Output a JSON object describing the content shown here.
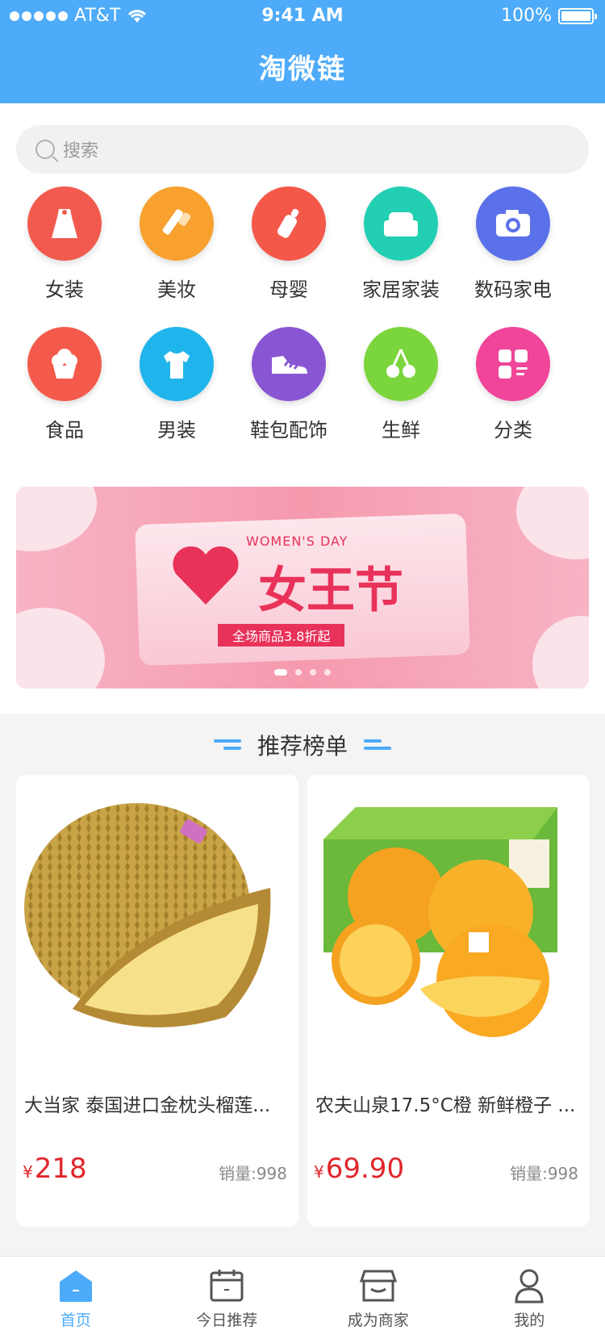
{
  "status_bar": {
    "carrier": "AT&T",
    "time": "9:41 AM",
    "battery": "100%"
  },
  "header": {
    "title": "淘微链"
  },
  "search": {
    "placeholder": "搜索"
  },
  "categories": [
    {
      "label": "女装",
      "icon": "dress-icon",
      "color": "#f25a4e"
    },
    {
      "label": "美妆",
      "icon": "lipstick-icon",
      "color": "#f8a12f"
    },
    {
      "label": "母婴",
      "icon": "baby-bottle-icon",
      "color": "#f45849"
    },
    {
      "label": "家居家装",
      "icon": "sofa-icon",
      "color": "#22cfb3"
    },
    {
      "label": "数码家电",
      "icon": "camera-icon",
      "color": "#5b71ea"
    },
    {
      "label": "食品",
      "icon": "cake-icon",
      "color": "#f45a4b"
    },
    {
      "label": "男装",
      "icon": "tshirt-icon",
      "color": "#1fb5ec"
    },
    {
      "label": "鞋包配饰",
      "icon": "shoe-icon",
      "color": "#8856d2"
    },
    {
      "label": "生鲜",
      "icon": "cherry-icon",
      "color": "#7bd53c"
    },
    {
      "label": "分类",
      "icon": "category-grid-icon",
      "color": "#f04598"
    }
  ],
  "banner": {
    "subtitle": "WOMEN'S DAY",
    "title": "女王节",
    "tagline": "全场商品3.8折起",
    "pages": 4,
    "active_page": 1
  },
  "recommend": {
    "title": "推荐榜单"
  },
  "products": [
    {
      "name": "大当家 泰国进口金枕头榴莲...",
      "currency": "¥",
      "price": "218",
      "sales": "销量:998"
    },
    {
      "name": "农夫山泉17.5°C橙 新鲜橙子 ...",
      "currency": "¥",
      "price": "69.90",
      "sales": "销量:998"
    }
  ],
  "tabs": [
    {
      "label": "首页",
      "icon": "home-icon",
      "active": true
    },
    {
      "label": "今日推荐",
      "icon": "calendar-icon",
      "active": false
    },
    {
      "label": "成为商家",
      "icon": "store-icon",
      "active": false
    },
    {
      "label": "我的",
      "icon": "user-icon",
      "active": false
    }
  ],
  "colors": {
    "primary": "#4dabf9",
    "price": "#e0262b"
  }
}
